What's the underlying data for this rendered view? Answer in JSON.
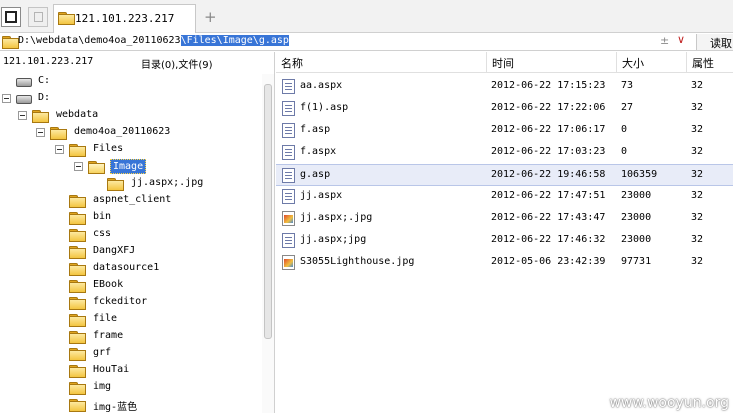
{
  "tabs": {
    "active_tab_label": "121.101.223.217",
    "add_tab_glyph": "+"
  },
  "address": {
    "path_plain": "D:\\webdata\\demo4oa_20110623",
    "path_selected": "\\Files\\Image\\g.asp",
    "plus_minus_glyph": "±",
    "dropdown_glyph": "∨",
    "read_button_label": "读取"
  },
  "left_header": {
    "host": "121.101.223.217",
    "stats": "目录(0),文件(9)"
  },
  "tree": [
    {
      "label": "C:",
      "icon": "drive-icon"
    },
    {
      "label": "D:",
      "icon": "drive-icon"
    },
    {
      "label": "webdata",
      "icon": "folder-icon"
    },
    {
      "label": "demo4oa_20110623",
      "icon": "folder-icon"
    },
    {
      "label": "Files",
      "icon": "folder-icon"
    },
    {
      "label": "Image",
      "icon": "open-folder-icon"
    },
    {
      "label": "jj.aspx;.jpg",
      "icon": "folder-icon"
    },
    {
      "label": "aspnet_client",
      "icon": "folder-icon"
    },
    {
      "label": "bin",
      "icon": "folder-icon"
    },
    {
      "label": "css",
      "icon": "folder-icon"
    },
    {
      "label": "DangXFJ",
      "icon": "folder-icon"
    },
    {
      "label": "datasource1",
      "icon": "folder-icon"
    },
    {
      "label": "EBook",
      "icon": "folder-icon"
    },
    {
      "label": "fckeditor",
      "icon": "folder-icon"
    },
    {
      "label": "file",
      "icon": "folder-icon"
    },
    {
      "label": "frame",
      "icon": "folder-icon"
    },
    {
      "label": "grf",
      "icon": "folder-icon"
    },
    {
      "label": "HouTai",
      "icon": "folder-icon"
    },
    {
      "label": "img",
      "icon": "folder-icon"
    },
    {
      "label": "img-蓝色",
      "icon": "folder-icon"
    }
  ],
  "columns": {
    "name": "名称",
    "time": "时间",
    "size": "大小",
    "attr": "属性"
  },
  "files": [
    {
      "name": "aa.aspx",
      "time": "2012-06-22 17:15:23",
      "size": "73",
      "attr": "32",
      "icon": "document-icon"
    },
    {
      "name": "f(1).asp",
      "time": "2012-06-22 17:22:06",
      "size": "27",
      "attr": "32",
      "icon": "script-file-icon"
    },
    {
      "name": "f.asp",
      "time": "2012-06-22 17:06:17",
      "size": "0",
      "attr": "32",
      "icon": "script-file-icon"
    },
    {
      "name": "f.aspx",
      "time": "2012-06-22 17:03:23",
      "size": "0",
      "attr": "32",
      "icon": "document-icon"
    },
    {
      "name": "g.asp",
      "time": "2012-06-22 19:46:58",
      "size": "106359",
      "attr": "32",
      "icon": "script-file-icon"
    },
    {
      "name": "jj.aspx",
      "time": "2012-06-22 17:47:51",
      "size": "23000",
      "attr": "32",
      "icon": "document-icon"
    },
    {
      "name": "jj.aspx;.jpg",
      "time": "2012-06-22 17:43:47",
      "size": "23000",
      "attr": "32",
      "icon": "image-file-icon"
    },
    {
      "name": "jj.aspx;jpg",
      "time": "2012-06-22 17:46:32",
      "size": "23000",
      "attr": "32",
      "icon": "script-file-icon"
    },
    {
      "name": "S3055Lighthouse.jpg",
      "time": "2012-05-06 23:42:39",
      "size": "97731",
      "attr": "32",
      "icon": "image-file-icon"
    }
  ],
  "selected_file": "g.asp",
  "watermark": "www.wooyun.org",
  "colors": {
    "selection": "#3875d7",
    "selected_row": "#e8ecf8"
  }
}
